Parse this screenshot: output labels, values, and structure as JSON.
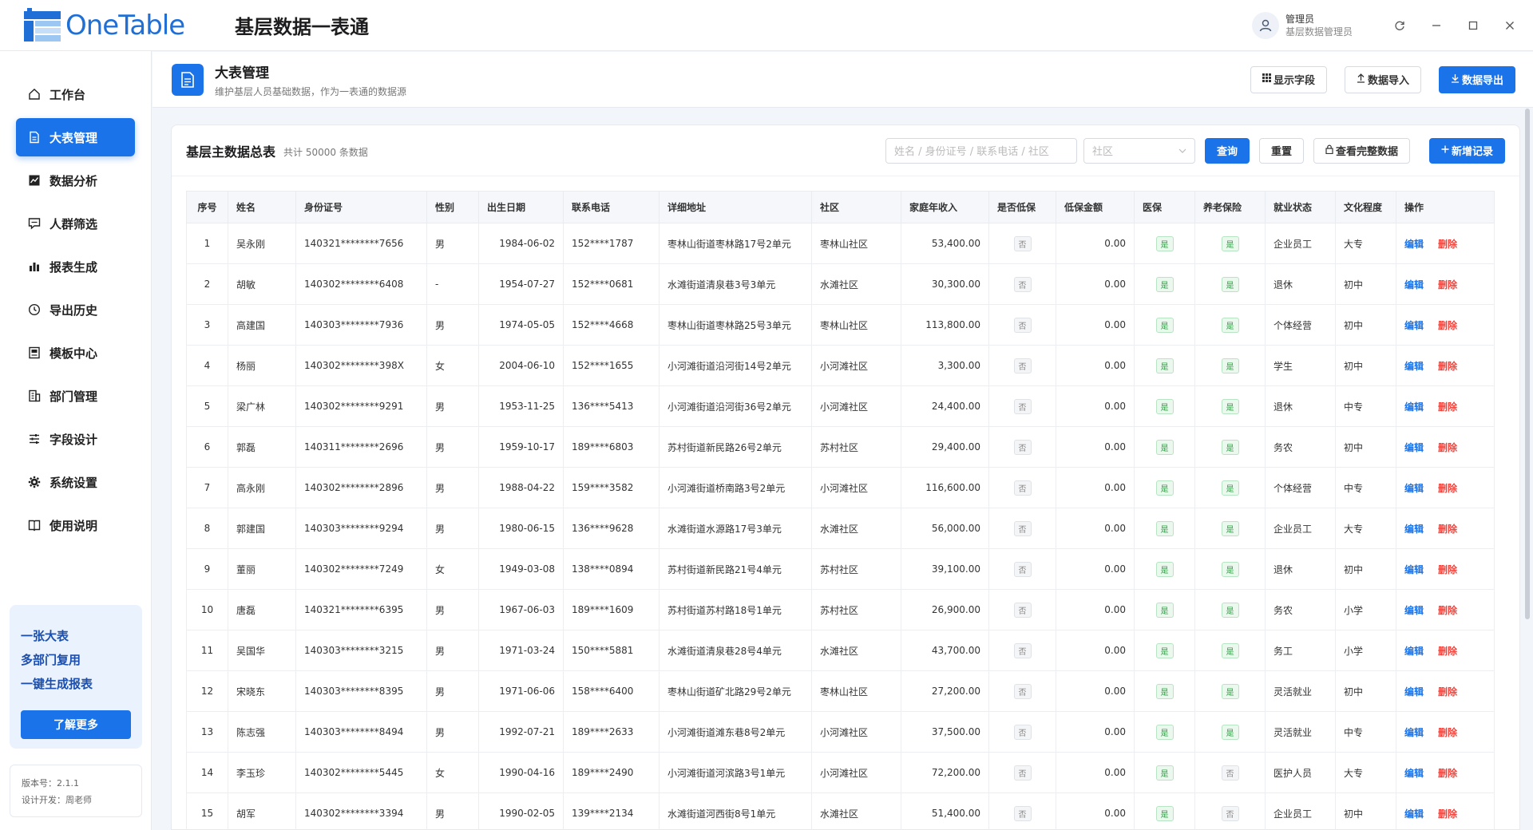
{
  "app": {
    "logo_text": "OneTable",
    "title": "基层数据一表通"
  },
  "user": {
    "name": "管理员",
    "role": "基层数据管理员"
  },
  "colors": {
    "accent": "#1a73e8",
    "danger": "#f0443c",
    "success": "#2f9e44"
  },
  "sidebar": {
    "items": [
      {
        "label": "工作台",
        "icon": "home-icon"
      },
      {
        "label": "大表管理",
        "icon": "document-icon"
      },
      {
        "label": "数据分析",
        "icon": "chart-line-icon"
      },
      {
        "label": "人群筛选",
        "icon": "chat-filter-icon"
      },
      {
        "label": "报表生成",
        "icon": "bar-chart-icon"
      },
      {
        "label": "导出历史",
        "icon": "clock-icon"
      },
      {
        "label": "模板中心",
        "icon": "template-icon"
      },
      {
        "label": "部门管理",
        "icon": "building-icon"
      },
      {
        "label": "字段设计",
        "icon": "sliders-icon"
      },
      {
        "label": "系统设置",
        "icon": "gear-icon"
      },
      {
        "label": "使用说明",
        "icon": "book-icon"
      }
    ],
    "promo": {
      "lines": [
        "一张大表",
        "多部门复用",
        "一键生成报表"
      ],
      "button": "了解更多"
    },
    "version": "版本号：2.1.1",
    "developer": "设计开发：周老师"
  },
  "page": {
    "title": "大表管理",
    "subtitle": "维护基层人员基础数据，作为一表通的数据源",
    "actions": {
      "fields": "显示字段",
      "import": "数据导入",
      "export": "数据导出"
    }
  },
  "card": {
    "title": "基层主数据总表",
    "count": "共计 50000 条数据",
    "search_placeholder": "姓名 / 身份证号 / 联系电话 / 社区",
    "community_placeholder": "社区",
    "query": "查询",
    "reset": "重置",
    "view_full": "查看完整数据",
    "add": "新增记录"
  },
  "table": {
    "columns": [
      "序号",
      "姓名",
      "身份证号",
      "性别",
      "出生日期",
      "联系电话",
      "详细地址",
      "社区",
      "家庭年收入",
      "是否低保",
      "低保金额",
      "医保",
      "养老保险",
      "就业状态",
      "文化程度",
      "操作"
    ],
    "edit_label": "编辑",
    "delete_label": "删除",
    "rows": [
      {
        "no": "1",
        "name": "吴永刚",
        "id": "140321********7656",
        "sex": "男",
        "birth": "1984-06-02",
        "phone": "152****1787",
        "addr": "枣林山街道枣林路17号2单元",
        "comm": "枣林山社区",
        "income": "53,400.00",
        "dibao": "否",
        "amount": "0.00",
        "yibao": "是",
        "yanglao": "是",
        "job": "企业员工",
        "edu": "大专"
      },
      {
        "no": "2",
        "name": "胡敏",
        "id": "140302********6408",
        "sex": "-",
        "birth": "1954-07-27",
        "phone": "152****0681",
        "addr": "水滩街道清泉巷3号3单元",
        "comm": "水滩社区",
        "income": "30,300.00",
        "dibao": "否",
        "amount": "0.00",
        "yibao": "是",
        "yanglao": "是",
        "job": "退休",
        "edu": "初中"
      },
      {
        "no": "3",
        "name": "高建国",
        "id": "140303********7936",
        "sex": "男",
        "birth": "1974-05-05",
        "phone": "152****4668",
        "addr": "枣林山街道枣林路25号3单元",
        "comm": "枣林山社区",
        "income": "113,800.00",
        "dibao": "否",
        "amount": "0.00",
        "yibao": "是",
        "yanglao": "是",
        "job": "个体经营",
        "edu": "初中"
      },
      {
        "no": "4",
        "name": "杨丽",
        "id": "140302********398X",
        "sex": "女",
        "birth": "2004-06-10",
        "phone": "152****1655",
        "addr": "小河滩街道沿河街14号2单元",
        "comm": "小河滩社区",
        "income": "3,300.00",
        "dibao": "否",
        "amount": "0.00",
        "yibao": "是",
        "yanglao": "是",
        "job": "学生",
        "edu": "初中"
      },
      {
        "no": "5",
        "name": "梁广林",
        "id": "140302********9291",
        "sex": "男",
        "birth": "1953-11-25",
        "phone": "136****5413",
        "addr": "小河滩街道沿河街36号2单元",
        "comm": "小河滩社区",
        "income": "24,400.00",
        "dibao": "否",
        "amount": "0.00",
        "yibao": "是",
        "yanglao": "是",
        "job": "退休",
        "edu": "中专"
      },
      {
        "no": "6",
        "name": "郭磊",
        "id": "140311********2696",
        "sex": "男",
        "birth": "1959-10-17",
        "phone": "189****6803",
        "addr": "苏村街道新民路26号2单元",
        "comm": "苏村社区",
        "income": "29,400.00",
        "dibao": "否",
        "amount": "0.00",
        "yibao": "是",
        "yanglao": "是",
        "job": "务农",
        "edu": "初中"
      },
      {
        "no": "7",
        "name": "高永刚",
        "id": "140302********2896",
        "sex": "男",
        "birth": "1988-04-22",
        "phone": "159****3582",
        "addr": "小河滩街道桥南路3号2单元",
        "comm": "小河滩社区",
        "income": "116,600.00",
        "dibao": "否",
        "amount": "0.00",
        "yibao": "是",
        "yanglao": "是",
        "job": "个体经营",
        "edu": "中专"
      },
      {
        "no": "8",
        "name": "郭建国",
        "id": "140303********9294",
        "sex": "男",
        "birth": "1980-06-15",
        "phone": "136****9628",
        "addr": "水滩街道水源路17号3单元",
        "comm": "水滩社区",
        "income": "56,000.00",
        "dibao": "否",
        "amount": "0.00",
        "yibao": "是",
        "yanglao": "是",
        "job": "企业员工",
        "edu": "大专"
      },
      {
        "no": "9",
        "name": "董丽",
        "id": "140302********7249",
        "sex": "女",
        "birth": "1949-03-08",
        "phone": "138****0894",
        "addr": "苏村街道新民路21号4单元",
        "comm": "苏村社区",
        "income": "39,100.00",
        "dibao": "否",
        "amount": "0.00",
        "yibao": "是",
        "yanglao": "是",
        "job": "退休",
        "edu": "初中"
      },
      {
        "no": "10",
        "name": "唐磊",
        "id": "140321********6395",
        "sex": "男",
        "birth": "1967-06-03",
        "phone": "189****1609",
        "addr": "苏村街道苏村路18号1单元",
        "comm": "苏村社区",
        "income": "26,900.00",
        "dibao": "否",
        "amount": "0.00",
        "yibao": "是",
        "yanglao": "是",
        "job": "务农",
        "edu": "小学"
      },
      {
        "no": "11",
        "name": "吴国华",
        "id": "140303********3215",
        "sex": "男",
        "birth": "1971-03-24",
        "phone": "150****5881",
        "addr": "水滩街道清泉巷28号4单元",
        "comm": "水滩社区",
        "income": "43,700.00",
        "dibao": "否",
        "amount": "0.00",
        "yibao": "是",
        "yanglao": "是",
        "job": "务工",
        "edu": "小学"
      },
      {
        "no": "12",
        "name": "宋晓东",
        "id": "140303********8395",
        "sex": "男",
        "birth": "1971-06-06",
        "phone": "158****6400",
        "addr": "枣林山街道矿北路29号2单元",
        "comm": "枣林山社区",
        "income": "27,200.00",
        "dibao": "否",
        "amount": "0.00",
        "yibao": "是",
        "yanglao": "是",
        "job": "灵活就业",
        "edu": "初中"
      },
      {
        "no": "13",
        "name": "陈志强",
        "id": "140303********8494",
        "sex": "男",
        "birth": "1992-07-21",
        "phone": "189****2633",
        "addr": "小河滩街道滩东巷8号2单元",
        "comm": "小河滩社区",
        "income": "37,500.00",
        "dibao": "否",
        "amount": "0.00",
        "yibao": "是",
        "yanglao": "是",
        "job": "灵活就业",
        "edu": "中专"
      },
      {
        "no": "14",
        "name": "李玉珍",
        "id": "140302********5445",
        "sex": "女",
        "birth": "1990-04-16",
        "phone": "189****2490",
        "addr": "小河滩街道河滨路3号1单元",
        "comm": "小河滩社区",
        "income": "72,200.00",
        "dibao": "否",
        "amount": "0.00",
        "yibao": "是",
        "yanglao": "否",
        "job": "医护人员",
        "edu": "大专"
      },
      {
        "no": "15",
        "name": "胡军",
        "id": "140302********3394",
        "sex": "男",
        "birth": "1990-02-05",
        "phone": "139****2134",
        "addr": "水滩街道河西街8号1单元",
        "comm": "水滩社区",
        "income": "51,400.00",
        "dibao": "否",
        "amount": "0.00",
        "yibao": "是",
        "yanglao": "否",
        "job": "企业员工",
        "edu": "初中"
      }
    ]
  }
}
